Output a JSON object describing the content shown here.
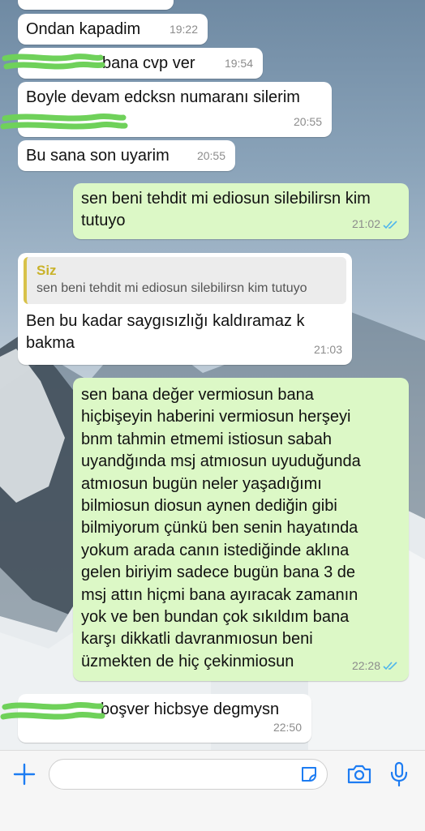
{
  "conversation": {
    "messages": [
      {
        "id": "m1",
        "direction": "incoming",
        "text": "Ondan kapadim",
        "time": "19:22"
      },
      {
        "id": "m2",
        "direction": "incoming",
        "text": "bana cvp ver",
        "time": "19:54"
      },
      {
        "id": "m3",
        "direction": "incoming",
        "text": "Boyle devam edcksn numaranı silerim",
        "time": "20:55"
      },
      {
        "id": "m4",
        "direction": "incoming",
        "text": "Bu sana son uyarim",
        "time": "20:55"
      },
      {
        "id": "m5",
        "direction": "outgoing",
        "text": "sen beni tehdit mi ediosun silebilirsn kim\ntutuyo",
        "time": "21:02",
        "status": "read"
      },
      {
        "id": "m6",
        "direction": "incoming",
        "reply_to": {
          "author": "Siz",
          "text": "sen beni tehdit mi ediosun silebilirsn kim tutuyo"
        },
        "text": "Ben bu kadar saygısızlığı kaldıramaz k\nbakma",
        "time": "21:03"
      },
      {
        "id": "m7",
        "direction": "outgoing",
        "text": "sen bana değer vermiosun bana\nhiçbişeyin haberini vermiosun herşeyi\nbnm tahmin etmemi istiosun sabah\nuyandğında msj atmıosun uyuduğunda\natmıosun bugün neler yaşadığımı\nbilmiosun diosun aynen dediğin gibi\nbilmiyorum çünkü ben senin hayatında\nyokum arada canın istediğinde aklına\ngelen biriyim sadece bugün bana 3 de\nmsj attın hiçmi bana ayıracak zamanın\nyok ve ben bundan çok sıkıldım bana\nkarşı dikkatli davranmıosun beni\nüzmekten de hiç çekinmiosun",
        "time": "22:28",
        "status": "read"
      },
      {
        "id": "m8",
        "direction": "incoming",
        "text": "boşver hicbsye degmysn",
        "time": "22:50"
      }
    ]
  },
  "composer": {
    "placeholder": "",
    "icons": {
      "attach": "plus-icon",
      "sticker": "sticker-icon",
      "camera": "camera-icon",
      "mic": "microphone-icon"
    }
  },
  "colors": {
    "incoming_bubble": "#ffffff",
    "outgoing_bubble": "#dcf8c6",
    "read_ticks": "#4fb6ec",
    "quote_accent": "#d8c24a",
    "icon_blue": "#1d7cf2",
    "redaction_scribble": "#6fd15a"
  }
}
